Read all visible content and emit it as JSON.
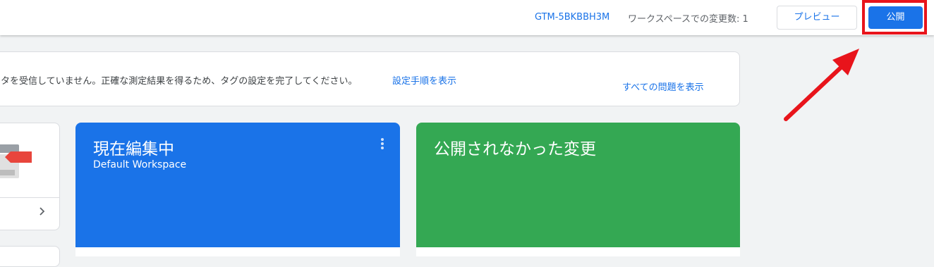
{
  "header": {
    "container_id": "GTM-5BKBBH3M",
    "workspace_changes": "ワークスペースでの変更数: 1",
    "preview_label": "プレビュー",
    "publish_label": "公開"
  },
  "notice": {
    "text": "タを受信していません。正確な測定結果を得るため、タグの設定を完了してください。",
    "setup_link": "設定手順を表示",
    "all_issues_link": "すべての問題を表示"
  },
  "workspace_card": {
    "title": "現在編集中",
    "workspace_name": "Default Workspace",
    "color": "#1a73e8"
  },
  "unpublished_card": {
    "title": "公開されなかった変更",
    "color": "#34a853"
  },
  "annotation": {
    "highlight_color": "#e8141b",
    "arrow_color": "#e8141b"
  },
  "icons": {
    "more": "more-vert-icon",
    "chevron": "chevron-right-icon"
  }
}
